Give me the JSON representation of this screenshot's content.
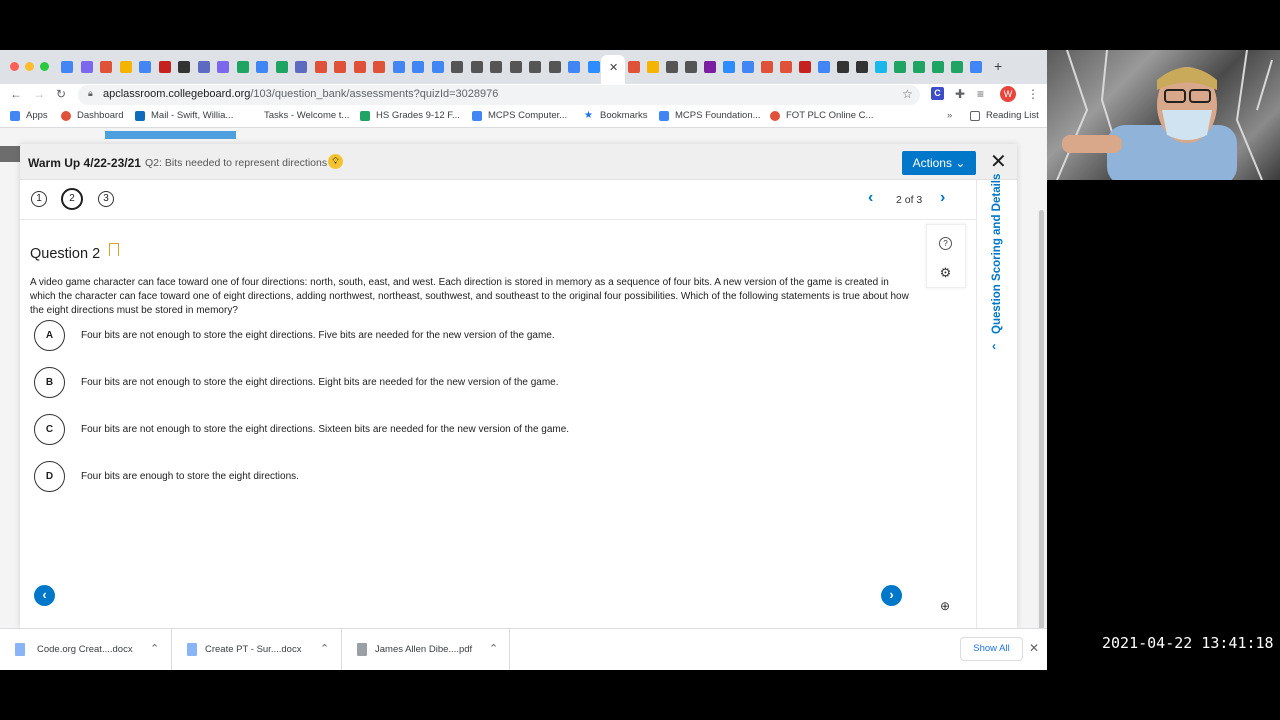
{
  "browser": {
    "url_host": "apclassroom.collegeboard.org",
    "url_path": "/103/question_bank/assessments?quizId=3028976",
    "bookmarks": [
      "Apps",
      "Dashboard",
      "Mail - Swift, Willia...",
      "Tasks - Welcome t...",
      "HS Grades 9-12 F...",
      "MCPS Computer...",
      "Bookmarks",
      "MCPS Foundation...",
      "FOT PLC Online C...",
      "Reading List"
    ],
    "profile_initial": "W"
  },
  "modal": {
    "title": "Warm Up 4/22-23/21",
    "subtitle": "Q2: Bits needed to represent directions",
    "actions_label": "Actions",
    "question_numbers": [
      "1",
      "2",
      "3"
    ],
    "pager": "2 of 3",
    "side_panel_label": "Question Scoring and Details"
  },
  "question": {
    "title": "Question 2",
    "stem": "A video game character can face toward one of four directions: north, south, east, and west. Each direction is stored in memory as a sequence of four bits. A new version of the game is created in which the character can face toward one of eight directions, adding northwest, northeast, southwest, and southeast to the original four possibilities. Which of the following statements is true about how the eight directions must be stored in memory?",
    "choices": [
      {
        "letter": "A",
        "text": "Four bits are not enough to store the eight directions. Five bits are needed for the new version of the game."
      },
      {
        "letter": "B",
        "text": "Four bits are not enough to store the eight directions. Eight bits are needed for the new version of the game."
      },
      {
        "letter": "C",
        "text": "Four bits are not enough to store the eight directions. Sixteen bits are needed for the new version of the game."
      },
      {
        "letter": "D",
        "text": "Four bits are enough to store the eight directions."
      }
    ]
  },
  "downloads": {
    "files": [
      "Code.org Creat....docx",
      "Create PT - Sur....docx",
      "James Allen Dibe....pdf"
    ],
    "show_all": "Show All"
  },
  "overlay": {
    "timestamp": "2021-04-22  13:41:18"
  },
  "colors": {
    "accent": "#0077c8",
    "bulb": "#f4c430"
  }
}
